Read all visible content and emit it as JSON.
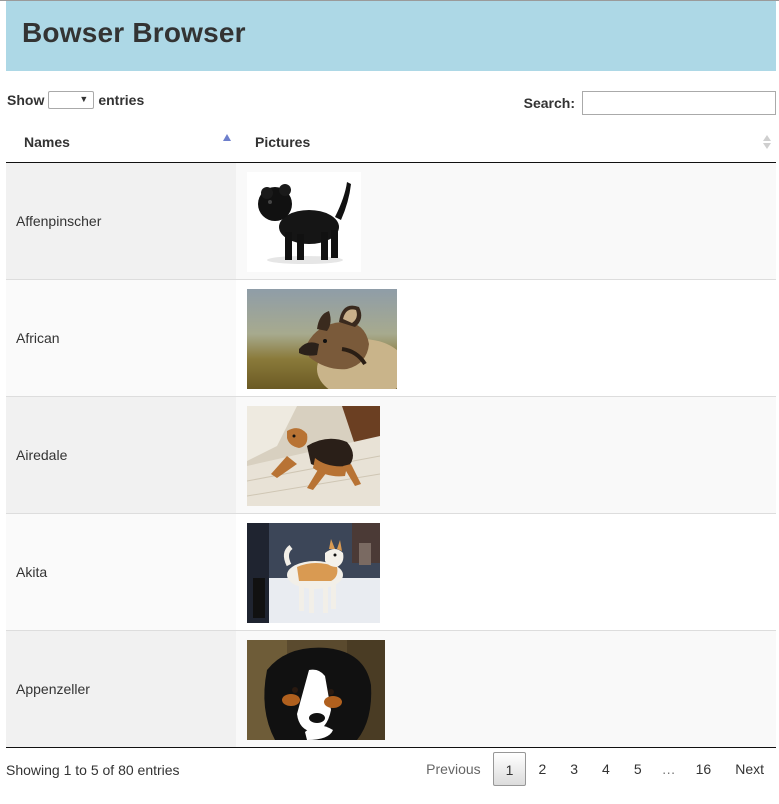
{
  "header": {
    "title": "Bowser Browser"
  },
  "length": {
    "show_label": "Show",
    "entries_label": "entries",
    "selected": ""
  },
  "search": {
    "label": "Search:",
    "value": "",
    "placeholder": ""
  },
  "table": {
    "columns": [
      "Names",
      "Pictures"
    ],
    "sort": {
      "column": "Names",
      "direction": "ascending"
    },
    "rows": [
      {
        "name": "Affenpinscher",
        "picture": "black shaggy small dog on white background"
      },
      {
        "name": "African",
        "picture": "african wild dog with large round ears"
      },
      {
        "name": "Airedale",
        "picture": "tan and black terrier lying on floor"
      },
      {
        "name": "Akita",
        "picture": "white and tan akita standing on snow"
      },
      {
        "name": "Appenzeller",
        "picture": "tricolor black white tan dog face"
      }
    ]
  },
  "info": "Showing 1 to 5 of 80 entries",
  "pagination": {
    "previous": "Previous",
    "pages": [
      "1",
      "2",
      "3",
      "4",
      "5"
    ],
    "current": "1",
    "ellipsis": "…",
    "last": "16",
    "next": "Next"
  },
  "colors": {
    "header_bg": "#add8e6",
    "sort_active": "#6d7fcc"
  }
}
